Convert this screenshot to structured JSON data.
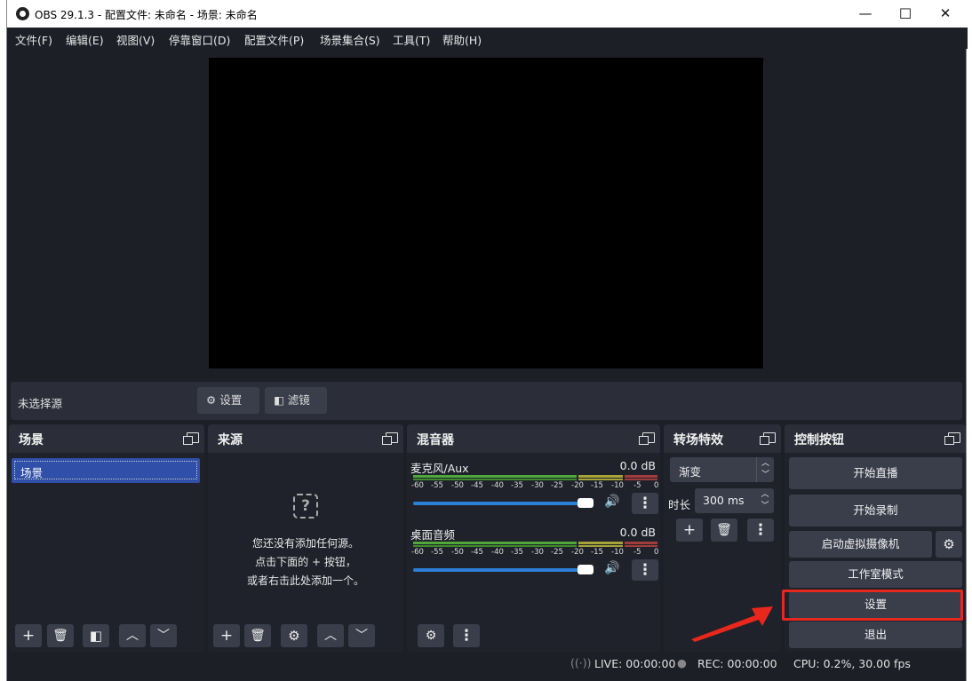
{
  "window": {
    "title": "OBS 29.1.3 - 配置文件: 未命名 - 场景: 未命名",
    "minimize": "—",
    "maximize": "☐",
    "close": "✕"
  },
  "menu": [
    "文件(F)",
    "编辑(E)",
    "视图(V)",
    "停靠窗口(D)",
    "配置文件(P)",
    "场景集合(S)",
    "工具(T)",
    "帮助(H)"
  ],
  "source_toolbar": {
    "no_source_label": "未选择源",
    "settings_label": "设置",
    "filters_label": "滤镜"
  },
  "scenes": {
    "title": "场景",
    "items": [
      "场景"
    ]
  },
  "sources": {
    "title": "来源",
    "empty_line1": "您还没有添加任何源。",
    "empty_line2": "点击下面的 + 按钮，",
    "empty_line3": "或者右击此处添加一个。"
  },
  "mixer": {
    "title": "混音器",
    "channels": [
      {
        "name": "麦克风/Aux",
        "db": "0.0 dB"
      },
      {
        "name": "桌面音频",
        "db": "0.0 dB"
      }
    ],
    "scale": [
      "-60",
      "-55",
      "-50",
      "-45",
      "-40",
      "-35",
      "-30",
      "-25",
      "-20",
      "-15",
      "-10",
      "-5",
      "0"
    ]
  },
  "transitions": {
    "title": "转场特效",
    "selected": "渐变",
    "duration_label": "时长",
    "duration_value": "300 ms"
  },
  "controls": {
    "title": "控制按钮",
    "start_stream": "开始直播",
    "start_record": "开始录制",
    "virtual_cam": "启动虚拟摄像机",
    "studio_mode": "工作室模式",
    "settings": "设置",
    "exit": "退出"
  },
  "status": {
    "live": "LIVE: 00:00:00",
    "rec": "REC: 00:00:00",
    "cpu": "CPU: 0.2%, 30.00 fps"
  },
  "colors": {
    "accent": "#2c7fd6",
    "annotation": "#e8271d"
  }
}
